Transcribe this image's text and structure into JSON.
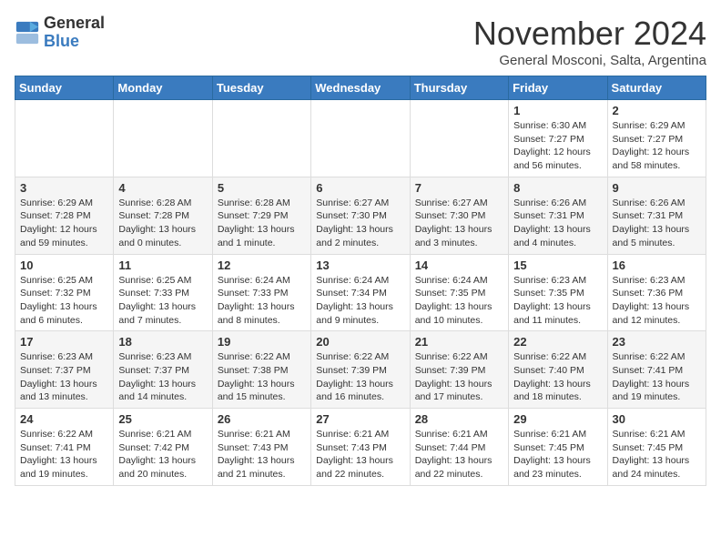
{
  "logo": {
    "general": "General",
    "blue": "Blue"
  },
  "header": {
    "month_title": "November 2024",
    "subtitle": "General Mosconi, Salta, Argentina"
  },
  "weekdays": [
    "Sunday",
    "Monday",
    "Tuesday",
    "Wednesday",
    "Thursday",
    "Friday",
    "Saturday"
  ],
  "weeks": [
    [
      {
        "day": "",
        "info": ""
      },
      {
        "day": "",
        "info": ""
      },
      {
        "day": "",
        "info": ""
      },
      {
        "day": "",
        "info": ""
      },
      {
        "day": "",
        "info": ""
      },
      {
        "day": "1",
        "info": "Sunrise: 6:30 AM\nSunset: 7:27 PM\nDaylight: 12 hours\nand 56 minutes."
      },
      {
        "day": "2",
        "info": "Sunrise: 6:29 AM\nSunset: 7:27 PM\nDaylight: 12 hours\nand 58 minutes."
      }
    ],
    [
      {
        "day": "3",
        "info": "Sunrise: 6:29 AM\nSunset: 7:28 PM\nDaylight: 12 hours\nand 59 minutes."
      },
      {
        "day": "4",
        "info": "Sunrise: 6:28 AM\nSunset: 7:28 PM\nDaylight: 13 hours\nand 0 minutes."
      },
      {
        "day": "5",
        "info": "Sunrise: 6:28 AM\nSunset: 7:29 PM\nDaylight: 13 hours\nand 1 minute."
      },
      {
        "day": "6",
        "info": "Sunrise: 6:27 AM\nSunset: 7:30 PM\nDaylight: 13 hours\nand 2 minutes."
      },
      {
        "day": "7",
        "info": "Sunrise: 6:27 AM\nSunset: 7:30 PM\nDaylight: 13 hours\nand 3 minutes."
      },
      {
        "day": "8",
        "info": "Sunrise: 6:26 AM\nSunset: 7:31 PM\nDaylight: 13 hours\nand 4 minutes."
      },
      {
        "day": "9",
        "info": "Sunrise: 6:26 AM\nSunset: 7:31 PM\nDaylight: 13 hours\nand 5 minutes."
      }
    ],
    [
      {
        "day": "10",
        "info": "Sunrise: 6:25 AM\nSunset: 7:32 PM\nDaylight: 13 hours\nand 6 minutes."
      },
      {
        "day": "11",
        "info": "Sunrise: 6:25 AM\nSunset: 7:33 PM\nDaylight: 13 hours\nand 7 minutes."
      },
      {
        "day": "12",
        "info": "Sunrise: 6:24 AM\nSunset: 7:33 PM\nDaylight: 13 hours\nand 8 minutes."
      },
      {
        "day": "13",
        "info": "Sunrise: 6:24 AM\nSunset: 7:34 PM\nDaylight: 13 hours\nand 9 minutes."
      },
      {
        "day": "14",
        "info": "Sunrise: 6:24 AM\nSunset: 7:35 PM\nDaylight: 13 hours\nand 10 minutes."
      },
      {
        "day": "15",
        "info": "Sunrise: 6:23 AM\nSunset: 7:35 PM\nDaylight: 13 hours\nand 11 minutes."
      },
      {
        "day": "16",
        "info": "Sunrise: 6:23 AM\nSunset: 7:36 PM\nDaylight: 13 hours\nand 12 minutes."
      }
    ],
    [
      {
        "day": "17",
        "info": "Sunrise: 6:23 AM\nSunset: 7:37 PM\nDaylight: 13 hours\nand 13 minutes."
      },
      {
        "day": "18",
        "info": "Sunrise: 6:23 AM\nSunset: 7:37 PM\nDaylight: 13 hours\nand 14 minutes."
      },
      {
        "day": "19",
        "info": "Sunrise: 6:22 AM\nSunset: 7:38 PM\nDaylight: 13 hours\nand 15 minutes."
      },
      {
        "day": "20",
        "info": "Sunrise: 6:22 AM\nSunset: 7:39 PM\nDaylight: 13 hours\nand 16 minutes."
      },
      {
        "day": "21",
        "info": "Sunrise: 6:22 AM\nSunset: 7:39 PM\nDaylight: 13 hours\nand 17 minutes."
      },
      {
        "day": "22",
        "info": "Sunrise: 6:22 AM\nSunset: 7:40 PM\nDaylight: 13 hours\nand 18 minutes."
      },
      {
        "day": "23",
        "info": "Sunrise: 6:22 AM\nSunset: 7:41 PM\nDaylight: 13 hours\nand 19 minutes."
      }
    ],
    [
      {
        "day": "24",
        "info": "Sunrise: 6:22 AM\nSunset: 7:41 PM\nDaylight: 13 hours\nand 19 minutes."
      },
      {
        "day": "25",
        "info": "Sunrise: 6:21 AM\nSunset: 7:42 PM\nDaylight: 13 hours\nand 20 minutes."
      },
      {
        "day": "26",
        "info": "Sunrise: 6:21 AM\nSunset: 7:43 PM\nDaylight: 13 hours\nand 21 minutes."
      },
      {
        "day": "27",
        "info": "Sunrise: 6:21 AM\nSunset: 7:43 PM\nDaylight: 13 hours\nand 22 minutes."
      },
      {
        "day": "28",
        "info": "Sunrise: 6:21 AM\nSunset: 7:44 PM\nDaylight: 13 hours\nand 22 minutes."
      },
      {
        "day": "29",
        "info": "Sunrise: 6:21 AM\nSunset: 7:45 PM\nDaylight: 13 hours\nand 23 minutes."
      },
      {
        "day": "30",
        "info": "Sunrise: 6:21 AM\nSunset: 7:45 PM\nDaylight: 13 hours\nand 24 minutes."
      }
    ]
  ]
}
